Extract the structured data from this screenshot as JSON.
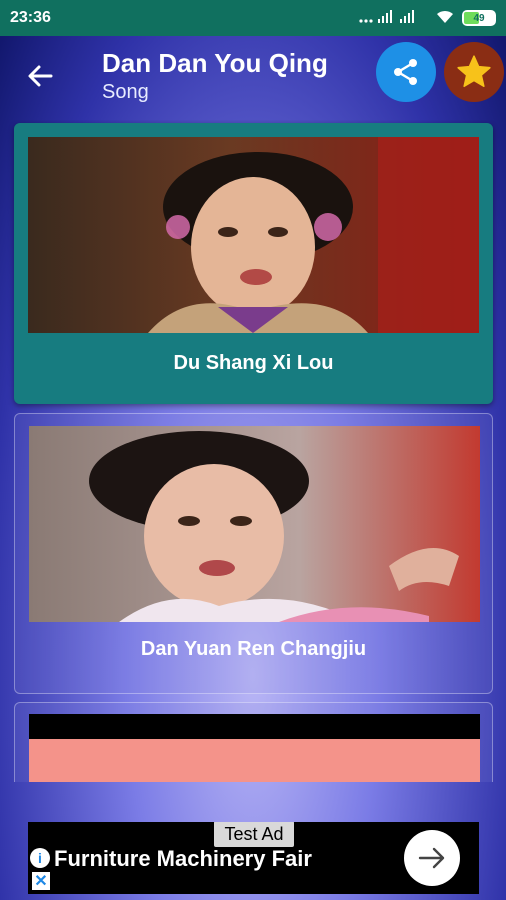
{
  "status_bar": {
    "time": "23:36",
    "signal_icons": "... ᵢıl ᵢıl",
    "battery_level": "49"
  },
  "header": {
    "title": "Dan Dan You Qing",
    "subtitle": "Song",
    "back_icon": "back-arrow-icon",
    "share_icon": "share-icon",
    "favorite_icon": "star-icon"
  },
  "songs": [
    {
      "title": "Du Shang Xi Lou",
      "selected": true
    },
    {
      "title": "Dan Yuan Ren Changjiu",
      "selected": false
    },
    {
      "title": "",
      "selected": false
    }
  ],
  "ad": {
    "tag": "Test Ad",
    "title": "Furniture Machinery Fair",
    "arrow_icon": "arrow-right-icon",
    "info_icon": "info-icon",
    "close_icon": "close-icon"
  },
  "colors": {
    "status_bar": "#10705f",
    "selected_card": "#177c80",
    "share_button": "#1e90e6",
    "favorite_button": "#8a2d14",
    "star": "#f7c21a"
  }
}
